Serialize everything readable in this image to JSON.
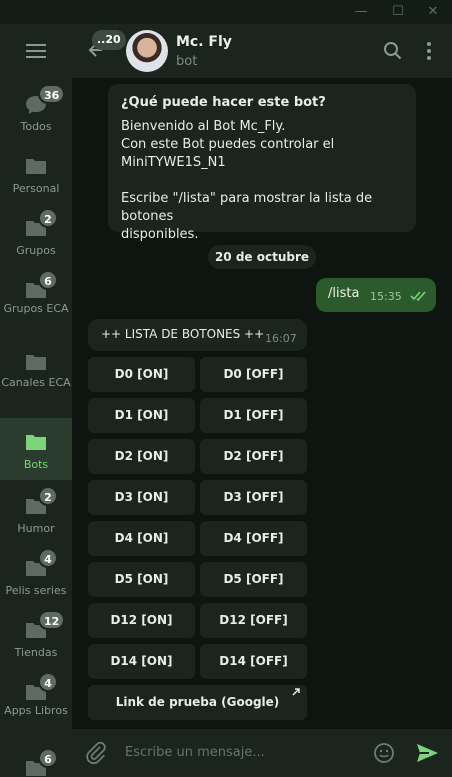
{
  "window": {
    "minimize": "—",
    "maximize": "☐",
    "close": "✕"
  },
  "sidebar": {
    "folders": [
      {
        "label": "Todos",
        "badge": "36",
        "icon": "chat-bubbles-icon"
      },
      {
        "label": "Personal",
        "badge": "",
        "icon": "folder-icon"
      },
      {
        "label": "Grupos",
        "badge": "2",
        "icon": "folder-icon"
      },
      {
        "label": "Grupos ECA",
        "badge": "6",
        "icon": "folder-icon"
      },
      {
        "label": "Canales ECA",
        "badge": "",
        "icon": "folder-icon"
      },
      {
        "label": "Bots",
        "badge": "",
        "icon": "folder-icon",
        "active": true
      },
      {
        "label": "Humor",
        "badge": "2",
        "icon": "folder-icon"
      },
      {
        "label": "Pelis series",
        "badge": "4",
        "icon": "folder-icon"
      },
      {
        "label": "Tiendas",
        "badge": "12",
        "icon": "folder-icon"
      },
      {
        "label": "Apps Libros",
        "badge": "4",
        "icon": "folder-icon"
      },
      {
        "label": "",
        "badge": "6",
        "icon": "folder-icon"
      }
    ]
  },
  "header": {
    "back_unread": "..20",
    "name": "Mc. Fly",
    "status": "bot"
  },
  "messages": {
    "description": {
      "title": "¿Qué puede hacer este bot?",
      "line1": "Bienvenido al Bot Mc_Fly.",
      "line2": "Con este Bot puedes controlar el",
      "line3": "MiniTYWE1S_N1",
      "line4": "Escribe \"/lista\" para mostrar la lista de botones",
      "line5": "disponibles."
    },
    "date": "20 de octubre",
    "outgoing": {
      "text": "/lista",
      "time": "15:35"
    },
    "incoming": {
      "text": "++ LISTA DE BOTONES ++",
      "time": "16:07"
    },
    "keyboard": [
      [
        "D0 [ON]",
        "D0 [OFF]"
      ],
      [
        "D1 [ON]",
        "D1 [OFF]"
      ],
      [
        "D2 [ON]",
        "D2 [OFF]"
      ],
      [
        "D3 [ON]",
        "D3 [OFF]"
      ],
      [
        "D4 [ON]",
        "D4 [OFF]"
      ],
      [
        "D5 [ON]",
        "D5 [OFF]"
      ],
      [
        "D12 [ON]",
        "D12 [OFF]"
      ],
      [
        "D14 [ON]",
        "D14 [OFF]"
      ]
    ],
    "link_button": "Link de prueba (Google)"
  },
  "composer": {
    "placeholder": "Escribe un mensaje..."
  },
  "colors": {
    "accent": "#7ed47a",
    "outgoing_bubble": "#2b5a2c",
    "panel": "#1b241d",
    "background": "#0e1510"
  }
}
